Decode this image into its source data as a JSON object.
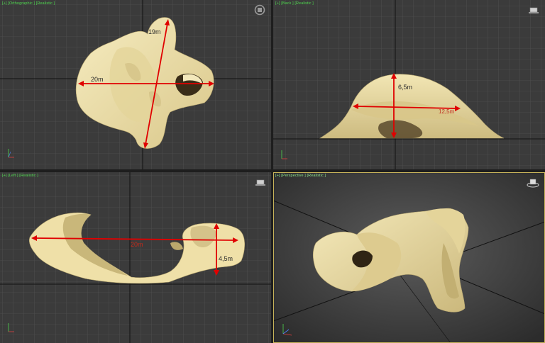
{
  "viewports": {
    "top": {
      "label": "[+] [Orthographic ] [Realistic ]",
      "dim_width": "20m",
      "dim_length": "19m"
    },
    "front": {
      "label": "[+] [Back ] [Realistic ]",
      "dim_height": "6,5m",
      "dim_width": "12,5m"
    },
    "left": {
      "label": "[+] [Left ] [Realistic ]",
      "dim_width": "20m",
      "dim_height": "4,5m"
    },
    "perspective": {
      "label": "[+] [Perspective ] [Realistic ]"
    }
  },
  "colors": {
    "grid_bg": "#3b3b3b",
    "grid_line": "#555555",
    "grid_axis": "#111111",
    "model": "#efe0a8",
    "dimension": "#e00000",
    "active_border": "#c8b45a"
  },
  "icons": [
    "viewcube-icon",
    "axis-tripod-icon",
    "steering-wheel-icon"
  ]
}
